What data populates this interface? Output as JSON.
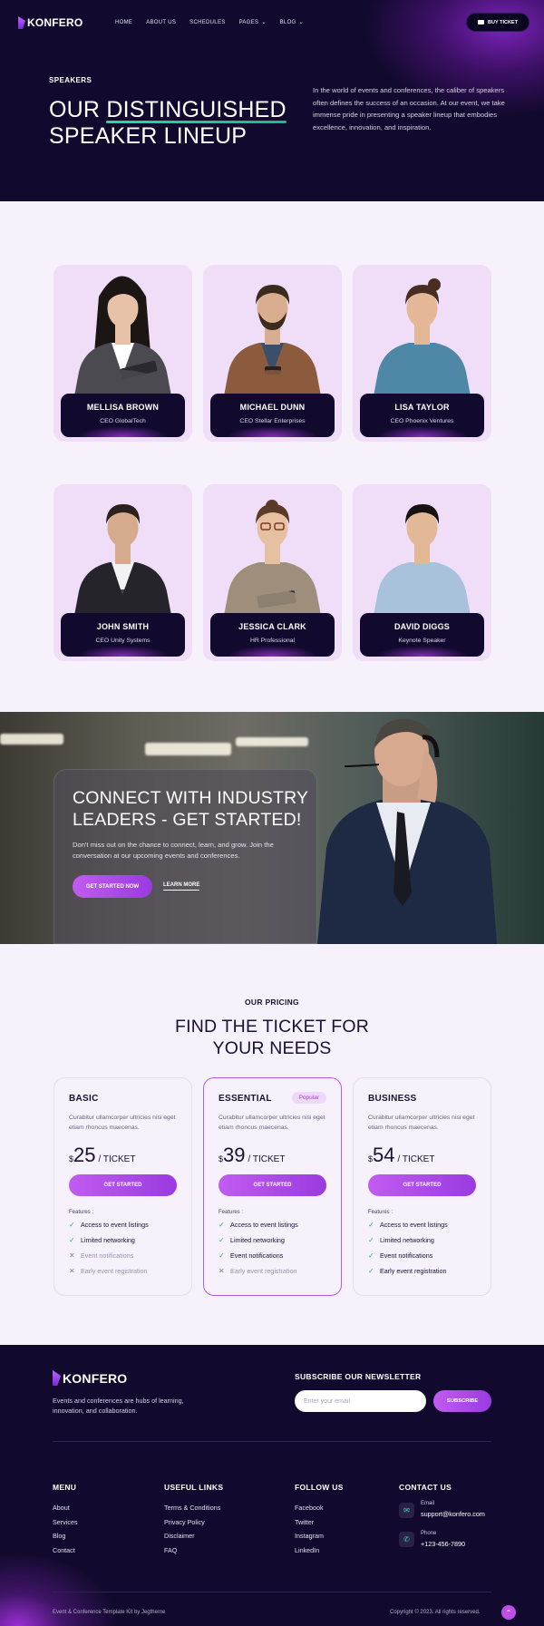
{
  "brand": {
    "name": "KONFERO",
    "accent": "#a642e0",
    "dark": "#120a2e",
    "green": "#1fb58a"
  },
  "nav": {
    "items": [
      "HOME",
      "ABOUT US",
      "SCHEDULES",
      "PAGES",
      "BLOG"
    ],
    "buy_ticket": "BUY TICKET"
  },
  "hero": {
    "eyebrow": "SPEAKERS",
    "title_part1": "OUR ",
    "title_highlight": "DISTINGUISHED",
    "title_part2": "SPEAKER LINEUP",
    "description": "In the world of events and conferences, the caliber of speakers often defines the success of an occasion. At our event, we take immense pride in presenting a speaker lineup that embodies excellence, innovation, and inspiration."
  },
  "speakers": [
    {
      "name": "MELLISA BROWN",
      "role": "CEO GlobalTech"
    },
    {
      "name": "MICHAEL DUNN",
      "role": "CEO Stellar Enterprises"
    },
    {
      "name": "LISA TAYLOR",
      "role": "CEO Phoenix Ventures"
    },
    {
      "name": "JOHN SMITH",
      "role": "CEO Unity Systems"
    },
    {
      "name": "JESSICA CLARK",
      "role": "HR Professional"
    },
    {
      "name": "DAVID DIGGS",
      "role": "Keynote Speaker"
    }
  ],
  "cta": {
    "title_line1": "CONNECT WITH INDUSTRY",
    "title_line2": "LEADERS - GET STARTED!",
    "description": "Don't miss out on the chance to connect, learn, and grow. Join the conversation at our upcoming events and conferences.",
    "primary": "GET STARTED NOW",
    "secondary": "LEARN MORE"
  },
  "pricing": {
    "eyebrow": "OUR PRICING",
    "title_line1": "FIND THE TICKET FOR",
    "title_line2": "YOUR NEEDS",
    "features_label": "Features :",
    "plans": [
      {
        "name": "BASIC",
        "badge": "",
        "desc": "Curabitur ullamcorper ultricies nisi eget etiam rhoncus maecenas.",
        "currency": "$",
        "price": "25",
        "per": "/ TICKET",
        "button": "GET STARTED",
        "features": [
          {
            "text": "Access to event listings",
            "ok": true
          },
          {
            "text": "Limited networking",
            "ok": true
          },
          {
            "text": "Event notifications",
            "ok": false
          },
          {
            "text": "Early event registration",
            "ok": false
          }
        ]
      },
      {
        "name": "ESSENTIAL",
        "badge": "Popular",
        "desc": "Curabitur ullamcorper ultricies nisi eget etiam rhoncus maecenas.",
        "currency": "$",
        "price": "39",
        "per": "/ TICKET",
        "button": "GET STARTED",
        "features": [
          {
            "text": "Access to event listings",
            "ok": true
          },
          {
            "text": "Limited networking",
            "ok": true
          },
          {
            "text": "Event notifications",
            "ok": true
          },
          {
            "text": "Early event registration",
            "ok": false
          }
        ]
      },
      {
        "name": "BUSINESS",
        "badge": "",
        "desc": "Curabitur ullamcorper ultricies nisi eget etiam rhoncus maecenas.",
        "currency": "$",
        "price": "54",
        "per": "/ TICKET",
        "button": "GET STARTED",
        "features": [
          {
            "text": "Access to event listings",
            "ok": true
          },
          {
            "text": "Limited networking",
            "ok": true
          },
          {
            "text": "Event notifications",
            "ok": true
          },
          {
            "text": "Early event registration",
            "ok": true
          }
        ]
      }
    ]
  },
  "footer": {
    "tagline": "Events and conferences are hubs of learning, innovation, and collaboration.",
    "newsletter": {
      "title": "SUBSCRIBE OUR NEWSLETTER",
      "placeholder": "Enter your email",
      "button": "SUBSCRIBE"
    },
    "menu": {
      "title": "MENU",
      "links": [
        "About",
        "Services",
        "Blog",
        "Contact"
      ]
    },
    "useful": {
      "title": "USEFUL LINKS",
      "links": [
        "Terms & Conditions",
        "Privacy Policy",
        "Disclaimer",
        "FAQ"
      ]
    },
    "follow": {
      "title": "FOLLOW US",
      "links": [
        "Facebook",
        "Twitter",
        "Instagram",
        "LinkedIn"
      ]
    },
    "contact": {
      "title": "CONTACT US",
      "email_label": "Email",
      "email": "support@konfero.com",
      "phone_label": "Phone",
      "phone": "+123-456-7890"
    },
    "credit": "Event & Conference Template Kit by Jegtheme",
    "copyright": "Copyright © 2023. All rights reserved."
  }
}
